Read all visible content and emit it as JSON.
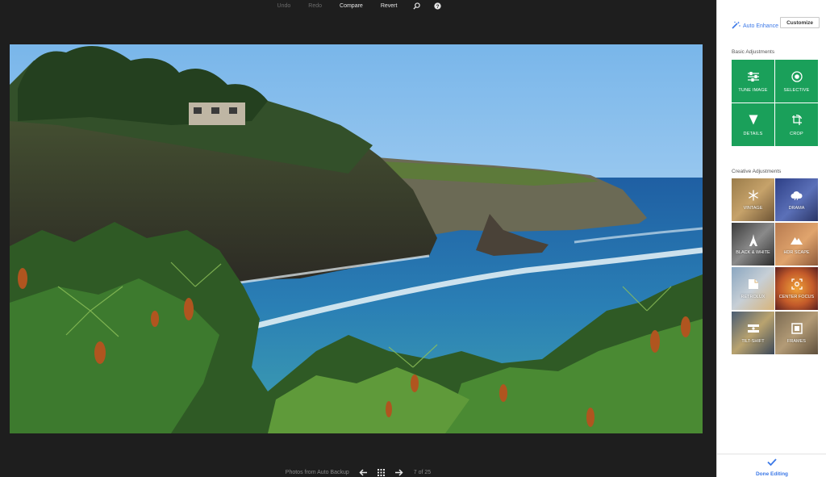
{
  "toolbar": {
    "undo": "Undo",
    "redo": "Redo",
    "compare": "Compare",
    "revert": "Revert"
  },
  "bottom_bar": {
    "album": "Photos from Auto Backup",
    "position": "7 of 25"
  },
  "panel": {
    "auto_enhance": "Auto Enhance",
    "customize": "Customize",
    "basic_title": "Basic Adjustments",
    "basic_tools": [
      "TUNE IMAGE",
      "SELECTIVE",
      "DETAILS",
      "CROP"
    ],
    "creative_title": "Creative Adjustments",
    "creative_tools": [
      "VINTAGE",
      "DRAMA",
      "BLACK & WHITE",
      "HDR SCAPE",
      "RETROLUX",
      "CENTER FOCUS",
      "TILT-SHIFT",
      "FRAMES"
    ],
    "done": "Done Editing"
  },
  "colors": {
    "accent_green": "#1aa05a",
    "link_blue": "#3b78e7",
    "editor_bg": "#1e1e1e"
  }
}
